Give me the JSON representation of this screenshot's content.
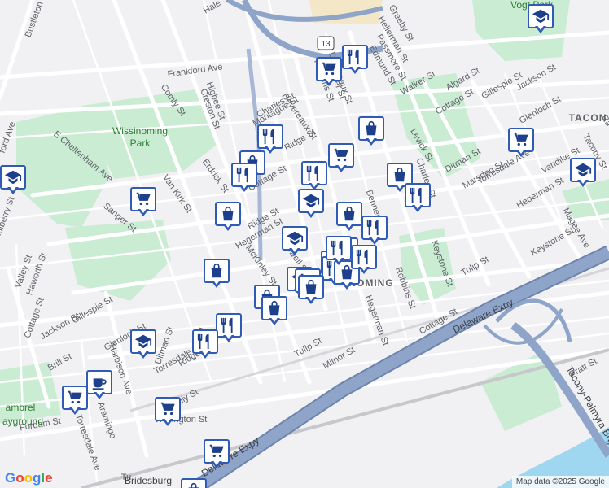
{
  "colors": {
    "background": "#f1f1f4",
    "park": "#c9ecd3",
    "water": "#9fd6f0",
    "highway": "#8ea4c9",
    "highway_edge": "#6d84ad",
    "minor_road": "#ffffff",
    "rail": "#c7c7cc",
    "pin_border": "#2f5bb7",
    "pin_icon": "#1d3f8c"
  },
  "neighborhoods": [
    "TACON",
    "NOMING"
  ],
  "parks": [
    "Vogt Park",
    "Wissinoming Park",
    "ambrel ayground"
  ],
  "places": [
    "Bridesburg"
  ],
  "highways": [
    "Delaware Expy",
    "Delaware Expy",
    "Tacony-Palmyra Brg"
  ],
  "route_shield": "13",
  "streets": [
    "Hale St",
    "Bustleton",
    "Frankford Ave",
    "Comly St",
    "Higbee St",
    "Creston St",
    "Charles St",
    "Devereaux St",
    "Greeby St",
    "Hellerman St",
    "Passmore St",
    "Robbins St",
    "Walker St",
    "Algard St",
    "Gillespie St",
    "Jackson St",
    "Cottage St",
    "Glenloch St",
    "Levick St",
    "Ditman St",
    "Torresdale Ave",
    "Marsden St",
    "Vandike St",
    "Hegerman St",
    "Magee Ave",
    "Keystone St",
    "Tulip St",
    "E Cheltenham Ave",
    "ford Ave",
    "Van Kirk St",
    "Erdrick St",
    "Sanger St",
    "Mulberry St",
    "Valley St",
    "Haworth St",
    "Cottage St",
    "Gillespie St",
    "Jackson St",
    "Glenloch St",
    "Brill St",
    "Harbison Ave",
    "Ditman St",
    "Torresdale Ave",
    "Comly St",
    "Howell St",
    "McKinley St",
    "Benner St",
    "Hegerman St",
    "Tulip St",
    "Milnor St",
    "Pratt St",
    "Torresdale Ave",
    "Fordam St",
    "Tu",
    "Wellington St",
    "Devereaux St",
    "Robbins St",
    "Keystone St",
    "Cottage St",
    "Ridge St",
    "Edmund St",
    "Charles St",
    "Montague St",
    "Ridge St",
    "Walker St",
    "Cottage St",
    "Hegerman St",
    "Ridge St",
    "Aramingo",
    "Kn",
    "Ra",
    "Tacony St"
  ],
  "pins": [
    {
      "icon": "school"
    },
    {
      "icon": "restaurant"
    },
    {
      "icon": "shopping-cart"
    },
    {
      "icon": "restaurant"
    },
    {
      "icon": "shopping-bag"
    },
    {
      "icon": "shopping-cart"
    },
    {
      "icon": "school"
    },
    {
      "icon": "restaurant"
    },
    {
      "icon": "shopping-bag"
    },
    {
      "icon": "restaurant"
    },
    {
      "icon": "shopping-bag"
    },
    {
      "icon": "shopping-bag"
    },
    {
      "icon": "shopping-cart"
    },
    {
      "icon": "school"
    },
    {
      "icon": "shopping-cart"
    },
    {
      "icon": "restaurant"
    },
    {
      "icon": "restaurant"
    },
    {
      "icon": "school"
    },
    {
      "icon": "shopping-bag"
    },
    {
      "icon": "restaurant"
    },
    {
      "icon": "school"
    },
    {
      "icon": "shopping-bag"
    },
    {
      "icon": "restaurant"
    },
    {
      "icon": "restaurant"
    },
    {
      "icon": "shopping-bag"
    },
    {
      "icon": "school"
    },
    {
      "icon": "shopping-cart"
    },
    {
      "icon": "shopping-bag"
    },
    {
      "icon": "shopping-bag"
    },
    {
      "icon": "restaurant"
    },
    {
      "icon": "restaurant"
    },
    {
      "icon": "school"
    },
    {
      "icon": "coffee"
    },
    {
      "icon": "shopping-cart"
    },
    {
      "icon": "shopping-cart"
    },
    {
      "icon": "shopping-cart"
    },
    {
      "icon": "shopping-bag"
    },
    {
      "icon": "restaurant"
    },
    {
      "icon": "shopping-bag"
    },
    {
      "icon": "restaurant"
    }
  ],
  "footer": {
    "logo": "Google",
    "attribution": "Map data ©2025 Google"
  }
}
